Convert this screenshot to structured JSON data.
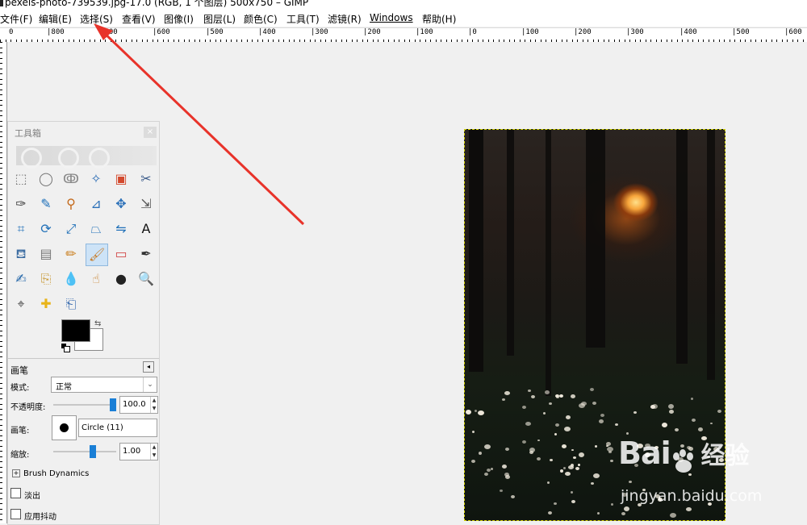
{
  "window": {
    "title": "pexels-photo-739539.jpg-17.0 (RGB, 1 个图层) 500x750 – GIMP"
  },
  "menubar": {
    "items": [
      "文件(F)",
      "编辑(E)",
      "选择(S)",
      "查看(V)",
      "图像(I)",
      "图层(L)",
      "颜色(C)",
      "工具(T)",
      "滤镜(R)",
      "Windows",
      "帮助(H)"
    ]
  },
  "ruler": {
    "labels": [
      "0",
      "|800",
      "|700",
      "|600",
      "|500",
      "|400",
      "|300",
      "|200",
      "|100",
      "|0",
      "|100",
      "|200",
      "|300",
      "|400",
      "|500",
      "|600"
    ]
  },
  "toolbox": {
    "title": "工具箱",
    "close_icon": "×",
    "tools": [
      "rect-select-icon",
      "ellipse-select-icon",
      "free-select-icon",
      "fuzzy-select-icon",
      "by-color-select-icon",
      "scissors-icon",
      "paths-icon",
      "color-picker-icon",
      "zoom-tool-icon",
      "measure-icon",
      "move-icon",
      "align-icon",
      "crop-icon",
      "rotate-icon",
      "scale-icon",
      "perspective-icon",
      "flip-icon",
      "text-icon",
      "bucket-fill-icon",
      "blend-icon",
      "pencil-icon",
      "paintbrush-icon",
      "eraser-icon",
      "airbrush-icon",
      "ink-icon",
      "clone-icon",
      "blur-icon",
      "smudge-icon",
      "dodge-burn-icon",
      "magnify-icon",
      "cage-transform-icon",
      "heal-icon",
      "perspective-clone-icon"
    ],
    "active_tool": "paintbrush-icon",
    "colors": {
      "foreground": "#000000",
      "background": "#ffffff"
    }
  },
  "tool_options": {
    "title": "画笔",
    "mode_label": "模式:",
    "mode_value": "正常",
    "opacity_label": "不透明度:",
    "opacity_value": "100.0",
    "opacity_fraction": 1.0,
    "brush_label": "画笔:",
    "brush_value": "Circle (11)",
    "scale_label": "缩放:",
    "scale_value": "1.00",
    "dynamics_label": "Brush Dynamics",
    "fade_label": "淡出",
    "jitter_label": "应用抖动"
  },
  "watermark": {
    "brand": "Bai",
    "brand2": "经验",
    "url": "jingyan.baidu.com"
  },
  "accent": "#1a7fd6",
  "arrow_color": "#e8332a"
}
